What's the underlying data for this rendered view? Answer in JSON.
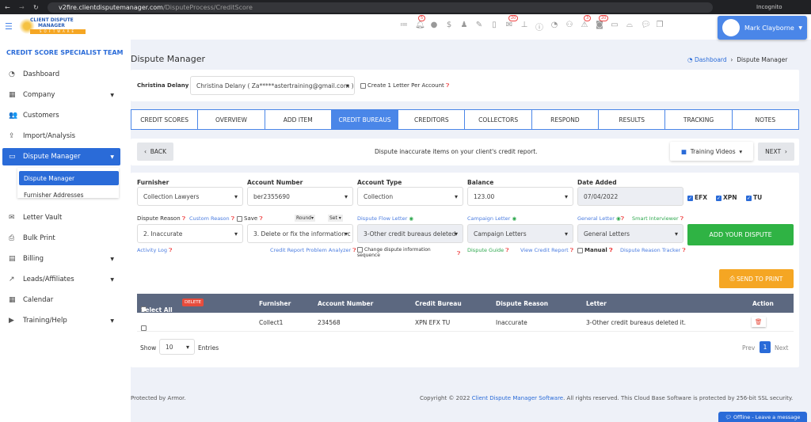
{
  "browser": {
    "url_host": "v2fire.clientdisputemanager.com",
    "url_path": "/DisputeProcess/CreditScore",
    "mode": "Incognito"
  },
  "logo": {
    "line1": "CLIENT DISPUTE",
    "line2": "MANAGER",
    "line3": "SOFTWARE"
  },
  "toolbar": {
    "badges": {
      "notifications": "5",
      "mail": "20",
      "alerts": "3",
      "messages": "20"
    }
  },
  "user": {
    "name": "Mark Clayborne"
  },
  "sidebar": {
    "title": "CREDIT SCORE SPECIALIST TEAM",
    "items": [
      {
        "label": "Dashboard",
        "icon": "◔"
      },
      {
        "label": "Company",
        "icon": "▦"
      },
      {
        "label": "Customers",
        "icon": "👥"
      },
      {
        "label": "Import/Analysis",
        "icon": "⇪"
      },
      {
        "label": "Dispute Manager",
        "icon": "▭"
      },
      {
        "label": "Letter Vault",
        "icon": "✉"
      },
      {
        "label": "Bulk Print",
        "icon": "⎙"
      },
      {
        "label": "Billing",
        "icon": "▤"
      },
      {
        "label": "Leads/Affiliates",
        "icon": "↗"
      },
      {
        "label": "Calendar",
        "icon": "▦"
      },
      {
        "label": "Training/Help",
        "icon": "▶"
      }
    ],
    "submenu": [
      "Dispute Manager",
      "Furnisher Addresses"
    ]
  },
  "page": {
    "title": "Dispute Manager",
    "breadcrumb": [
      "Dashboard",
      "Dispute Manager"
    ]
  },
  "client": {
    "label": "Christina Delany",
    "selected": "Christina Delany ( Za*****astertraining@gmail.com )",
    "one_letter": "Create 1 Letter Per Account"
  },
  "tabs": [
    "CREDIT SCORES",
    "OVERVIEW",
    "ADD ITEM",
    "CREDIT BUREAUS",
    "CREDITORS",
    "COLLECTORS",
    "RESPOND",
    "RESULTS",
    "TRACKING",
    "NOTES"
  ],
  "active_tab": "CREDIT BUREAUS",
  "nav": {
    "back": "BACK",
    "message": "Dispute inaccurate items on your client's credit report.",
    "training": "Training Videos",
    "next": "NEXT"
  },
  "form": {
    "furnisher_label": "Furnisher",
    "furnisher": "Collection Lawyers",
    "account_label": "Account Number",
    "account": "ber2355690",
    "type_label": "Account Type",
    "type": "Collection",
    "balance_label": "Balance",
    "balance": "123.00",
    "date_label": "Date Added",
    "date": "07/04/2022",
    "bureaus": [
      "EFX",
      "XPN",
      "TU"
    ],
    "reason_label": "Dispute Reason",
    "custom_reason": "Custom Reason",
    "save": "Save",
    "round": "Round",
    "set": "Set",
    "reason": "2. Inaccurate",
    "instruction": "3. Delete or fix the information c",
    "flow_label": "Dispute Flow Letter",
    "flow": "3-Other credit bureaus deleted",
    "campaign_label": "Campaign Letter",
    "campaign": "Campaign Letters",
    "general_label": "General Letter",
    "smart": "Smart Interviewer",
    "general": "General Letters",
    "add": "ADD YOUR DISPUTE",
    "activity": "Activity Log",
    "analyzer": "Credit Report Problem Analyzer",
    "change_seq": "Change dispute information sequence",
    "guide": "Dispute Guide",
    "view_report": "View Credit Report",
    "manual": "Manual",
    "tracker": "Dispute Reason Tracker",
    "print": "SEND TO PRINT"
  },
  "table": {
    "select_all": "Select All",
    "delete": "DELETE",
    "headers": [
      "Furnisher",
      "Account Number",
      "Credit Bureau",
      "Dispute Reason",
      "Letter",
      "Action"
    ],
    "rows": [
      {
        "furnisher": "Collect1",
        "account": "234568",
        "bureau": "XPN EFX TU",
        "reason": "Inaccurate",
        "letter": "3-Other credit bureaus deleted it."
      }
    ]
  },
  "pagination": {
    "show": "Show",
    "entries_value": "10",
    "entries": "Entries",
    "prev": "Prev",
    "page": "1",
    "next": "Next"
  },
  "footer": {
    "left": "Protected by Armor.",
    "copy": "Copyright © 2022",
    "brand": "Client Dispute Manager Software",
    "rest": ". All rights reserved. This Cloud Base Software is protected by 256-bit SSL security."
  },
  "chat": {
    "label": "Offline - Leave a message"
  },
  "colors": {
    "primary": "#2a6bd8",
    "tab_active": "#4a86e8",
    "add": "#2fb344",
    "print": "#f5a623",
    "delete": "#e74c3c"
  }
}
